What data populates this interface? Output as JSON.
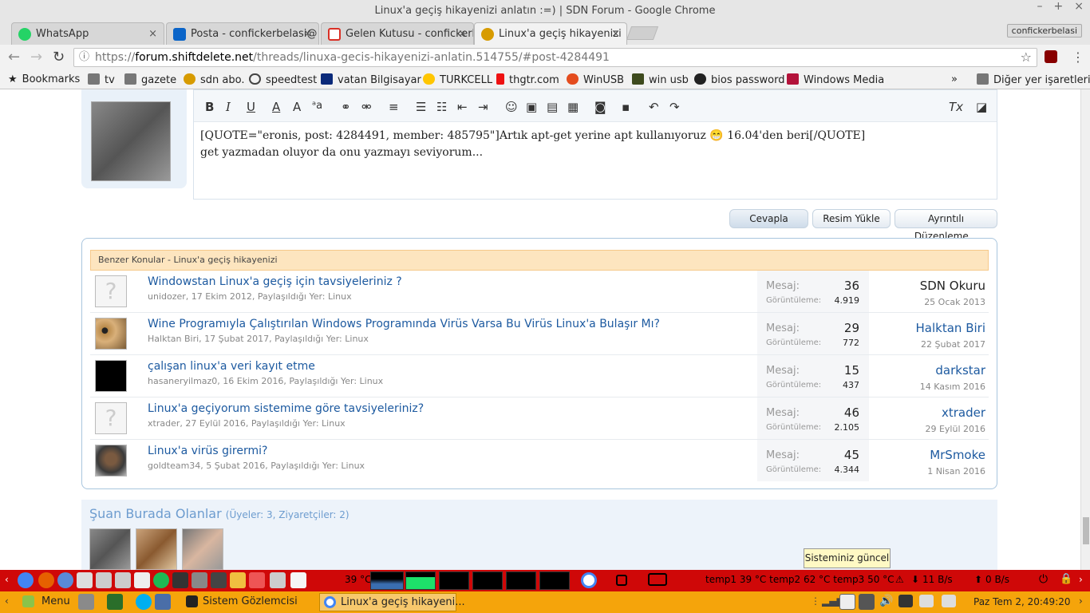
{
  "window": {
    "title": "Linux'a geçiş hikayenizi anlatın :=) | SDN Forum - Google Chrome"
  },
  "tabs": [
    {
      "label": "WhatsApp",
      "color": "#25d366"
    },
    {
      "label": "Posta - confickerbelasi@",
      "color": "#0a64c8"
    },
    {
      "label": "Gelen Kutusu - confickerb",
      "color": "#d93025"
    },
    {
      "label": "Linux'a geçiş hikayenizi",
      "color": "#d79b00"
    }
  ],
  "profile_name": "confickerbelasi",
  "address": {
    "scheme": "https://",
    "host": "forum.shiftdelete.net",
    "path": "/threads/linuxa-gecis-hikayenizi-anlatin.514755/#post-4284491"
  },
  "bookmarks": [
    "Bookmarks",
    "tv",
    "gazete",
    "sdn abo.",
    "speedtest",
    "vatan Bilgisayar",
    "TURKCELL",
    "thgtr.com",
    "WinUSB",
    "win usb",
    "bios password",
    "Windows Media"
  ],
  "bookmarks_more": "»",
  "other_bookmarks": "Diğer yer işaretleri",
  "editor": {
    "line1": "[QUOTE=\"eronis, post: 4284491, member: 485795\"]Artık apt-get yerine apt kullanıyoruz 😁 16.04'den beri[/QUOTE]",
    "line2": "get yazmadan oluyor da onu yazmayı seviyorum..."
  },
  "buttons": {
    "reply": "Cevapla",
    "upload": "Resim Yükle",
    "detailed": "Ayrıntılı Düzenleme..."
  },
  "similar": {
    "header": "Benzer Konular - Linux'a geçiş hikayenizi",
    "stat_label_1": "Mesaj:",
    "stat_label_2": "Görüntüleme:",
    "rows": [
      {
        "title": "Windowstan Linux'a geçiş için tavsiyeleriniz ?",
        "meta": "unidozer, 17 Ekim 2012, Paylaşıldığı Yer: Linux",
        "replies": "36",
        "views": "4.919",
        "last_user": "SDN Okuru",
        "last_date": "25 Ocak 2013"
      },
      {
        "title": "Wine Programıyla Çalıştırılan Windows Programında Virüs Varsa Bu Virüs Linux'a Bulaşır Mı?",
        "meta": "Halktan Biri, 17 Şubat 2017, Paylaşıldığı Yer: Linux",
        "replies": "29",
        "views": "772",
        "last_user": "Halktan Biri",
        "last_date": "22 Şubat 2017"
      },
      {
        "title": "çalışan linux'a veri kayıt etme",
        "meta": "hasaneryilmaz0, 16 Ekim 2016, Paylaşıldığı Yer: Linux",
        "replies": "15",
        "views": "437",
        "last_user": "darkstar",
        "last_date": "14 Kasım 2016"
      },
      {
        "title": "Linux'a geçiyorum sistemime göre tavsiyeleriniz?",
        "meta": "xtrader, 27 Eylül 2016, Paylaşıldığı Yer: Linux",
        "replies": "46",
        "views": "2.105",
        "last_user": "xtrader",
        "last_date": "29 Eylül 2016"
      },
      {
        "title": "Linux'a virüs girermi?",
        "meta": "goldteam34, 5 Şubat 2016, Paylaşıldığı Yer: Linux",
        "replies": "45",
        "views": "4.344",
        "last_user": "MrSmoke",
        "last_date": "1 Nisan 2016"
      }
    ]
  },
  "online": {
    "title": "Şuan Burada Olanlar",
    "counts": "(Üyeler: 3, Ziyaretçiler: 2)"
  },
  "tooltip": "Sisteminiz güncel",
  "panel_top": {
    "cpu_temp": "39 °C",
    "sensors": "temp1 39 °C temp2 62 °C temp3 50 °C",
    "net_down": "11 B/s",
    "net_up": "0 B/s"
  },
  "panel_bottom": {
    "menu": "Menu",
    "task1": "Sistem Gözlemcisi",
    "task2": "Linux'a geçiş hikayeni...",
    "clock": "Paz Tem  2, 20:49:20"
  }
}
